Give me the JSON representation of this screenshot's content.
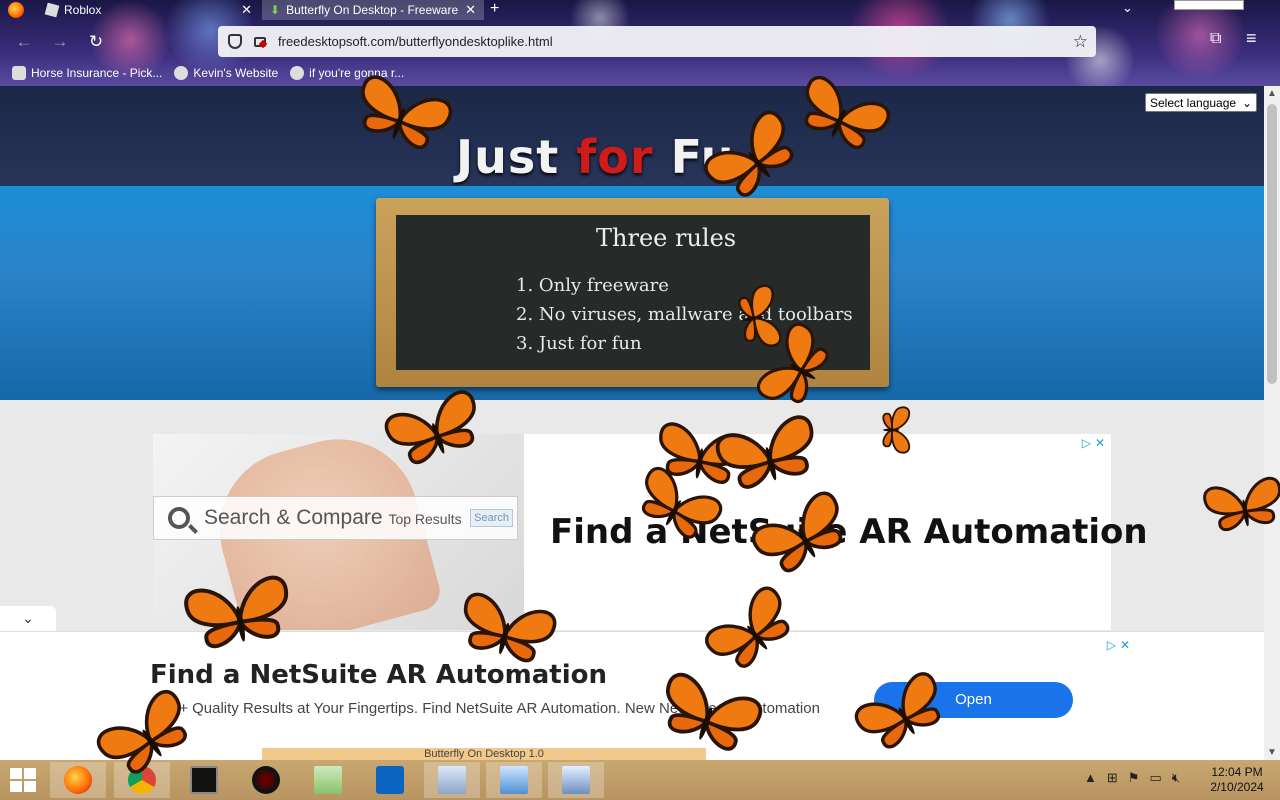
{
  "browser": {
    "tabs": [
      {
        "title": "Roblox",
        "close": "✕"
      },
      {
        "title": "Butterfly On Desktop - Freeware",
        "close": "✕"
      }
    ],
    "new_tab": "+",
    "url": "freedesktopsoft.com/butterflyondesktoplike.html",
    "bookmarks": [
      {
        "label": "Horse Insurance - Pick..."
      },
      {
        "label": "Kevin's Website"
      },
      {
        "label": "if you're gonna r..."
      }
    ]
  },
  "page": {
    "title_part1": "Just ",
    "title_accent": "for",
    "title_part2": " Fu",
    "language_select": "Select language",
    "board": {
      "title": "Three rules",
      "rules": [
        "1. Only freeware",
        "2. No viruses, mallware and toolbars",
        "3. Just for fun"
      ]
    },
    "ad_top": {
      "search_text": "Search & Compare",
      "search_small": "Top Results",
      "search_button": "Search",
      "headline": "Find a NetSuite AR Automation"
    },
    "ad_bottom": {
      "headline": "Find a NetSuite AR Automation",
      "description": "10 0+ Quality Results at Your Fingertips. Find NetSuite AR Automation. New NetSuite AR Automation",
      "button": "Open",
      "strip_text": "Butterfly On Desktop 1.0"
    }
  },
  "taskbar": {
    "time": "12:04 PM",
    "date": "2/10/2024"
  },
  "colors": {
    "accent_red": "#d01b1b",
    "hero_blue": "#1c8ed6",
    "open_button": "#1a73e8",
    "butterfly_orange": "#f07a12"
  }
}
